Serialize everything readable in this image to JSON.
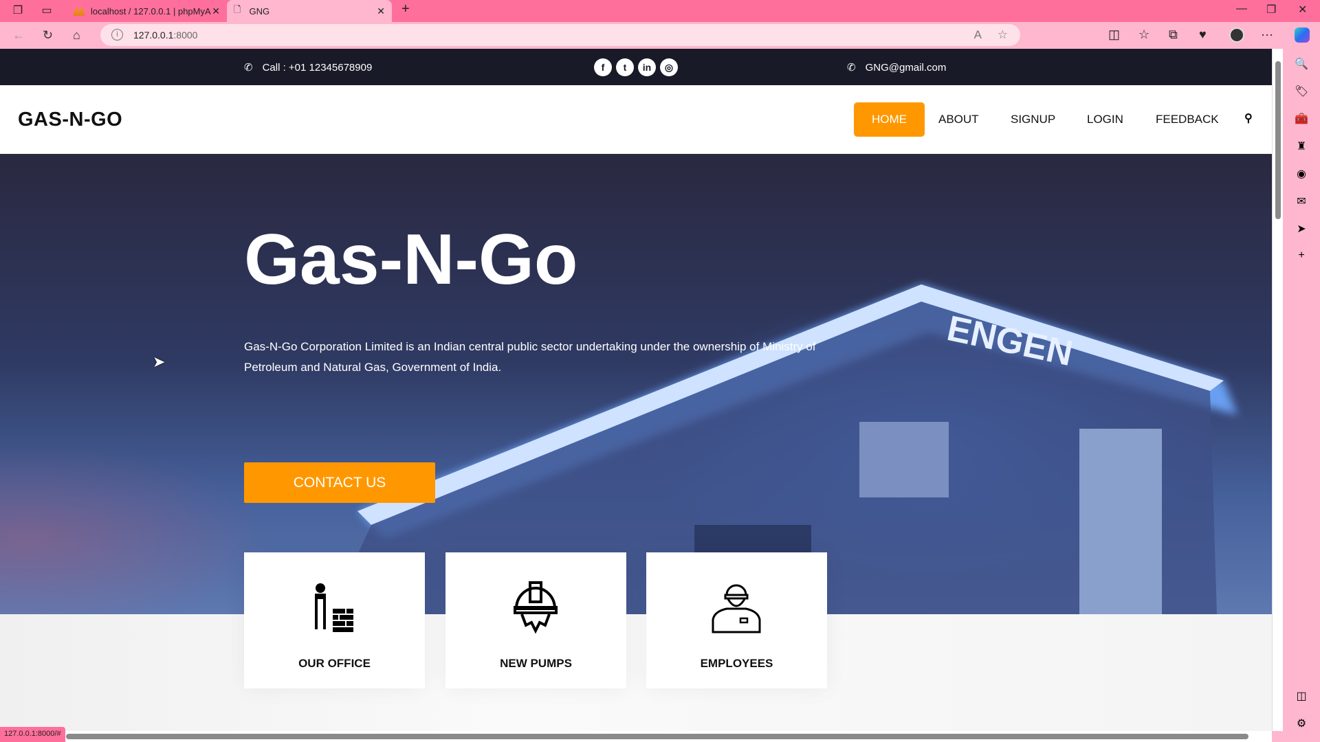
{
  "browser": {
    "tabs": [
      {
        "label": "localhost / 127.0.0.1 | phpMyAdmin",
        "icon": "phpmyadmin-icon"
      },
      {
        "label": "GNG",
        "icon": "page-icon",
        "active": true
      }
    ],
    "address_host": "127.0.0.1",
    "address_port": ":8000",
    "status_url": "127.0.0.1:8000/#",
    "colors": {
      "frame": "#ff6f9b",
      "toolbar": "#ffb6cf"
    }
  },
  "topbar": {
    "phone": "Call : +01 12345678909",
    "email": "GNG@gmail.com",
    "social": [
      "facebook",
      "twitter",
      "linkedin",
      "instagram"
    ]
  },
  "navbar": {
    "logo": "GAS-N-GO",
    "menu": [
      "HOME",
      "ABOUT",
      "SIGNUP",
      "LOGIN",
      "FEEDBACK"
    ],
    "active": "HOME",
    "accent": "#ff9800"
  },
  "hero": {
    "title": "Gas-N-Go",
    "text": "Gas-N-Go Corporation Limited is an Indian central public sector undertaking under the ownership of Ministry of Petroleum and Natural Gas, Government of India.",
    "button": "CONTACT US",
    "sign": "ENGEN"
  },
  "cards": [
    {
      "label": "OUR OFFICE",
      "icon": "builder-icon"
    },
    {
      "label": "NEW PUMPS",
      "icon": "helmet-gear-icon"
    },
    {
      "label": "EMPLOYEES",
      "icon": "worker-icon"
    }
  ]
}
